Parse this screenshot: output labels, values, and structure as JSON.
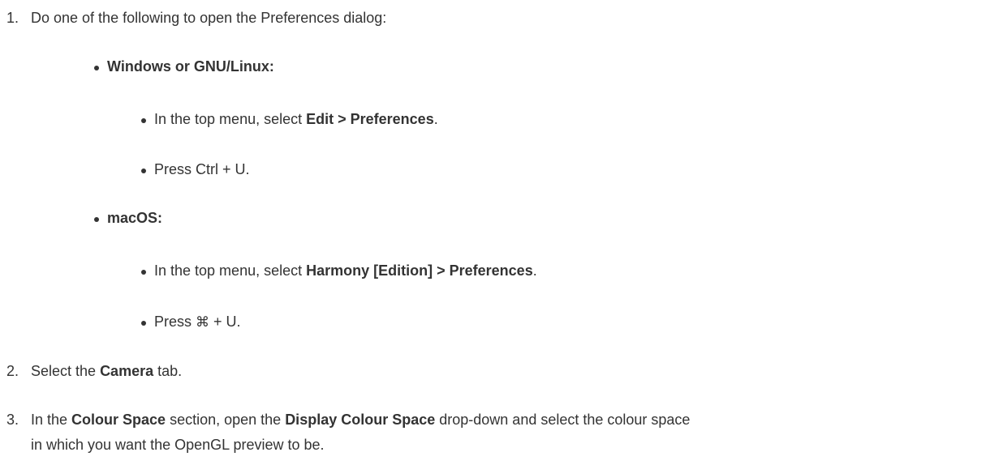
{
  "steps": [
    {
      "number": "1.",
      "text": "Do one of the following to open the Preferences dialog:",
      "platforms": [
        {
          "name": "Windows or GNU/Linux:",
          "items": [
            {
              "prefix": "In the top menu, select ",
              "bold": "Edit > Preferences",
              "suffix": "."
            },
            {
              "prefix": "Press Ctrl + U.",
              "bold": "",
              "suffix": ""
            }
          ]
        },
        {
          "name": "macOS:",
          "items": [
            {
              "prefix": "In the top menu, select ",
              "bold": "Harmony [Edition] > Preferences",
              "suffix": "."
            },
            {
              "prefix": "Press ",
              "key": "⌘",
              "suffix": " + U."
            }
          ]
        }
      ]
    },
    {
      "number": "2.",
      "prefix": "Select the ",
      "bold": "Camera",
      "suffix": " tab."
    },
    {
      "number": "3.",
      "prefix": "In the ",
      "bold1": "Colour Space",
      "middle": " section, open the ",
      "bold2": "Display Colour Space",
      "suffix": " drop-down and select the colour space",
      "line2": "in which you want the OpenGL preview to be."
    }
  ]
}
